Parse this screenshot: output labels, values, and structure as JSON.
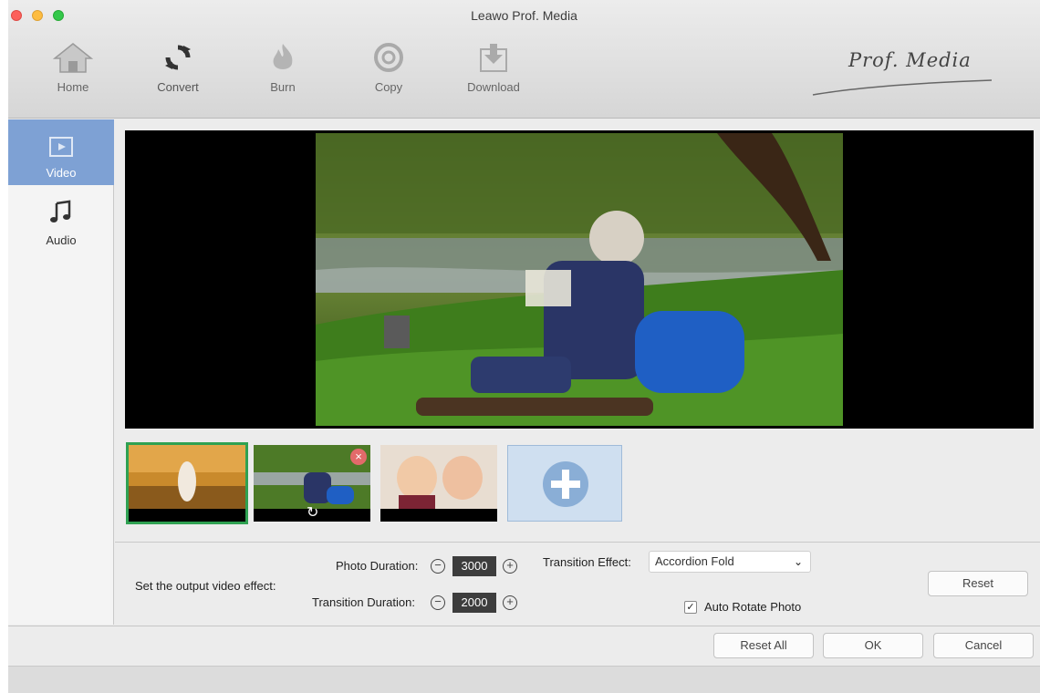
{
  "window": {
    "title": "Leawo Prof. Media"
  },
  "toolbar": {
    "items": [
      {
        "label": "Home",
        "icon": "home-icon"
      },
      {
        "label": "Convert",
        "icon": "convert-icon"
      },
      {
        "label": "Burn",
        "icon": "burn-icon"
      },
      {
        "label": "Copy",
        "icon": "copy-icon"
      },
      {
        "label": "Download",
        "icon": "download-icon"
      }
    ],
    "brand": "Prof. Media"
  },
  "sidebar": {
    "items": [
      {
        "label": "Video",
        "icon": "video-icon",
        "active": true
      },
      {
        "label": "Audio",
        "icon": "music-note-icon",
        "active": false
      }
    ]
  },
  "thumbnails": {
    "count": 3,
    "selected_index": 0
  },
  "effects": {
    "set_label": "Set the output video effect:",
    "photo_duration_label": "Photo Duration:",
    "photo_duration_value": "3000",
    "transition_duration_label": "Transition Duration:",
    "transition_duration_value": "2000",
    "transition_effect_label": "Transition Effect:",
    "transition_effect_value": "Accordion Fold",
    "auto_rotate_label": "Auto Rotate Photo",
    "auto_rotate_checked": true,
    "reset_label": "Reset"
  },
  "footer": {
    "reset_all_label": "Reset All",
    "ok_label": "OK",
    "cancel_label": "Cancel"
  },
  "colors": {
    "sidebar_active": "#7ea1d4",
    "thumb_selected": "#2fa152",
    "preview_bg": "#000000"
  }
}
